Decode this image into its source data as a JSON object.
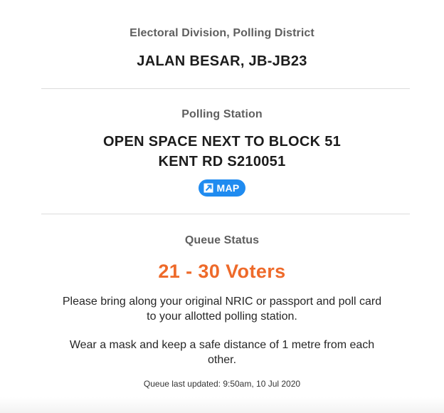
{
  "district": {
    "label": "Electoral Division, Polling District",
    "value": "JALAN BESAR, JB-JB23"
  },
  "station": {
    "label": "Polling Station",
    "line1": "OPEN SPACE NEXT TO BLOCK 51",
    "line2": "KENT RD S210051",
    "map_button": {
      "icon": "external-link-icon",
      "label": "MAP",
      "color": "#1f8bf0"
    }
  },
  "queue": {
    "label": "Queue Status",
    "count": "21 - 30 Voters",
    "count_color": "#ee6a2a",
    "instruction_line1": "Please bring along your original NRIC or passport and poll card",
    "instruction_line2": "to your allotted polling station.",
    "mask_line1": "Wear a mask and keep a safe distance of 1 metre from each",
    "mask_line2": "other.",
    "last_updated": "Queue last updated: 9:50am, 10 Jul 2020"
  }
}
